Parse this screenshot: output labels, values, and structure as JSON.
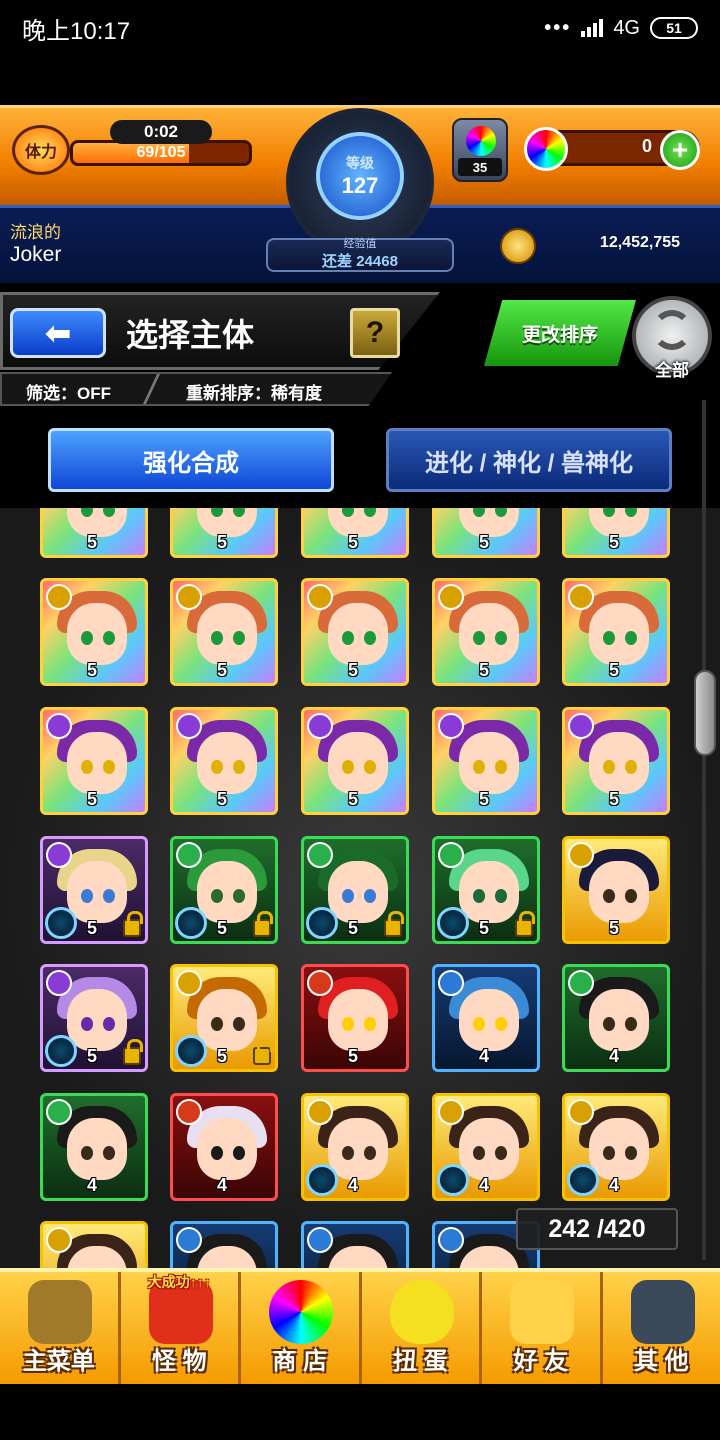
{
  "status_bar": {
    "time": "晚上10:17",
    "network": "4G",
    "battery": "51"
  },
  "header": {
    "stamina_label": "体力",
    "stamina_timer": "0:02",
    "stamina_value": "69/105",
    "stamina_ratio": 0.657,
    "rank_label": "等级",
    "rank_value": "127",
    "exp_label": "经验值",
    "exp_remaining": "还差 24468",
    "orb_potion_count": "35",
    "orb_count": "0",
    "player_title": "流浪的",
    "player_name": "Joker",
    "gold": "12,452,755"
  },
  "toolbar": {
    "title": "选择主体",
    "help": "?",
    "filter": "筛选：OFF",
    "sort": "重新排序：稀有度",
    "change_sort": "更改排序",
    "all": "全部"
  },
  "tabs": {
    "active": "强化合成",
    "inactive": "进化 / 神化 / 兽神化"
  },
  "monsters": [
    {
      "frame": "rainbow",
      "elem": "#d8a000",
      "hair": "#d96a3a",
      "eye": "#1a9a3a",
      "level": "5"
    },
    {
      "frame": "rainbow",
      "elem": "#d8a000",
      "hair": "#d96a3a",
      "eye": "#1a9a3a",
      "level": "5"
    },
    {
      "frame": "rainbow",
      "elem": "#d8a000",
      "hair": "#d96a3a",
      "eye": "#1a9a3a",
      "level": "5"
    },
    {
      "frame": "rainbow",
      "elem": "#d8a000",
      "hair": "#d96a3a",
      "eye": "#1a9a3a",
      "level": "5"
    },
    {
      "frame": "rainbow",
      "elem": "#d8a000",
      "hair": "#d96a3a",
      "eye": "#1a9a3a",
      "level": "5"
    },
    {
      "frame": "rainbow",
      "elem": "#d8a000",
      "hair": "#d96a3a",
      "eye": "#1a9a3a",
      "level": "5"
    },
    {
      "frame": "rainbow",
      "elem": "#d8a000",
      "hair": "#d96a3a",
      "eye": "#1a9a3a",
      "level": "5"
    },
    {
      "frame": "rainbow",
      "elem": "#d8a000",
      "hair": "#d96a3a",
      "eye": "#1a9a3a",
      "level": "5"
    },
    {
      "frame": "rainbow",
      "elem": "#d8a000",
      "hair": "#d96a3a",
      "eye": "#1a9a3a",
      "level": "5"
    },
    {
      "frame": "rainbow",
      "elem": "#d8a000",
      "hair": "#d96a3a",
      "eye": "#1a9a3a",
      "level": "5"
    },
    {
      "frame": "rainbow",
      "elem": "#8a3ad6",
      "hair": "#7a2aa8",
      "eye": "#e0b000",
      "level": "5"
    },
    {
      "frame": "rainbow",
      "elem": "#8a3ad6",
      "hair": "#7a2aa8",
      "eye": "#e0b000",
      "level": "5"
    },
    {
      "frame": "rainbow",
      "elem": "#8a3ad6",
      "hair": "#7a2aa8",
      "eye": "#e0b000",
      "level": "5"
    },
    {
      "frame": "rainbow",
      "elem": "#8a3ad6",
      "hair": "#7a2aa8",
      "eye": "#e0b000",
      "level": "5"
    },
    {
      "frame": "rainbow",
      "elem": "#8a3ad6",
      "hair": "#7a2aa8",
      "eye": "#e0b000",
      "level": "5"
    },
    {
      "frame": "purple",
      "elem": "#8a3ad6",
      "hair": "#e8d48a",
      "eye": "#3a7ad6",
      "level": "5",
      "gauge": true,
      "lock": true
    },
    {
      "frame": "green",
      "elem": "#2ab04a",
      "hair": "#2a9a3a",
      "eye": "#2a6a2a",
      "level": "5",
      "gauge": true,
      "lock": true
    },
    {
      "frame": "green",
      "elem": "#2ab04a",
      "hair": "#1a6a2a",
      "eye": "#3a7ad6",
      "level": "5",
      "gauge": true,
      "lock": true
    },
    {
      "frame": "green",
      "elem": "#2ab04a",
      "hair": "#5ad68a",
      "eye": "#1a6a3a",
      "level": "5",
      "gauge": true,
      "lock": true
    },
    {
      "frame": "gold",
      "elem": "#d8a000",
      "hair": "#1a1a3a",
      "eye": "#3a2a1a",
      "level": "5"
    },
    {
      "frame": "purple",
      "elem": "#8a3ad6",
      "hair": "#b48ae6",
      "eye": "#6a2aa8",
      "level": "5",
      "gauge": true,
      "lock": true
    },
    {
      "frame": "gold",
      "elem": "#d8a000",
      "hair": "#c46a00",
      "eye": "#3a2a1a",
      "level": "5",
      "gauge": true,
      "lock": true
    },
    {
      "frame": "red",
      "elem": "#d63a1a",
      "hair": "#e02020",
      "eye": "#ffd000",
      "level": "5"
    },
    {
      "frame": "blue",
      "elem": "#2a7ad6",
      "hair": "#3a8ad6",
      "eye": "#ffd000",
      "level": "4"
    },
    {
      "frame": "green",
      "elem": "#2ab04a",
      "hair": "#1a1a1a",
      "eye": "#3a2a1a",
      "level": "4"
    },
    {
      "frame": "green",
      "elem": "#2ab04a",
      "hair": "#1a1a1a",
      "eye": "#3a2a1a",
      "level": "4"
    },
    {
      "frame": "red",
      "elem": "#d63a1a",
      "hair": "#e8e0f0",
      "eye": "#1a1a1a",
      "level": "4"
    },
    {
      "frame": "gold",
      "elem": "#d8a000",
      "hair": "#3a2418",
      "eye": "#3a2a1a",
      "level": "4",
      "gauge": true
    },
    {
      "frame": "gold",
      "elem": "#d8a000",
      "hair": "#3a2418",
      "eye": "#3a2a1a",
      "level": "4",
      "gauge": true
    },
    {
      "frame": "gold",
      "elem": "#d8a000",
      "hair": "#3a2418",
      "eye": "#3a2a1a",
      "level": "4",
      "gauge": true
    },
    {
      "frame": "gold",
      "elem": "#d8a000",
      "hair": "#3a2418",
      "eye": "#3a2a1a",
      "level": ""
    },
    {
      "frame": "blue",
      "elem": "#2a7ad6",
      "hair": "#1a1a1a",
      "eye": "#3a2a1a",
      "level": ""
    },
    {
      "frame": "blue",
      "elem": "#2a7ad6",
      "hair": "#1a1a1a",
      "eye": "#3a2a1a",
      "level": ""
    },
    {
      "frame": "blue",
      "elem": "#2a7ad6",
      "hair": "#1a1a1a",
      "eye": "#3a2a1a",
      "level": ""
    }
  ],
  "box_count": "242 /420",
  "bottom_nav": {
    "items": [
      {
        "label": "主菜单",
        "icon": "castle-gate-icon",
        "color": "#a07a2a"
      },
      {
        "label": "怪 物",
        "icon": "monster-icon",
        "color": "#e0301a",
        "badge": "大成功↑↑↑"
      },
      {
        "label": "商 店",
        "icon": "rainbow-orb-icon",
        "color": "#ffffff"
      },
      {
        "label": "扭 蛋",
        "icon": "gacha-egg-icon",
        "color": "#f5e020"
      },
      {
        "label": "好 友",
        "icon": "friends-icon",
        "color": "#ffd24a"
      },
      {
        "label": "其 他",
        "icon": "other-icon",
        "color": "#3a4a5a"
      }
    ]
  }
}
